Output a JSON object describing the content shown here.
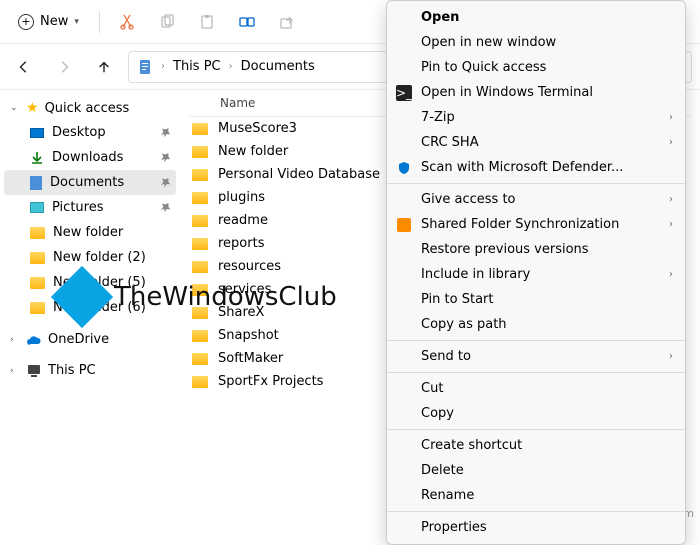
{
  "toolbar": {
    "new_label": "New"
  },
  "breadcrumb": {
    "segments": [
      "This PC",
      "Documents"
    ]
  },
  "sidebar": {
    "quick_access": "Quick access",
    "items": [
      {
        "label": "Desktop",
        "pinned": true,
        "icon": "desktop"
      },
      {
        "label": "Downloads",
        "pinned": true,
        "icon": "downloads"
      },
      {
        "label": "Documents",
        "pinned": true,
        "icon": "documents",
        "selected": true
      },
      {
        "label": "Pictures",
        "pinned": true,
        "icon": "pictures"
      },
      {
        "label": "New folder",
        "pinned": false,
        "icon": "folder"
      },
      {
        "label": "New folder (2)",
        "pinned": false,
        "icon": "folder"
      },
      {
        "label": "New folder (5)",
        "pinned": false,
        "icon": "folder"
      },
      {
        "label": "New folder (6)",
        "pinned": false,
        "icon": "folder"
      }
    ],
    "onedrive": "OneDrive",
    "this_pc": "This PC"
  },
  "content": {
    "column_header": "Name",
    "folders": [
      "MuseScore3",
      "New folder",
      "Personal Video Database",
      "plugins",
      "readme",
      "reports",
      "resources",
      "services",
      "ShareX",
      "Snapshot",
      "SoftMaker",
      "SportFx Projects"
    ]
  },
  "context_menu": {
    "groups": [
      [
        {
          "label": "Open",
          "bold": true
        },
        {
          "label": "Open in new window"
        },
        {
          "label": "Pin to Quick access"
        },
        {
          "label": "Open in Windows Terminal",
          "icon": "terminal"
        },
        {
          "label": "7-Zip",
          "submenu": true
        },
        {
          "label": "CRC SHA",
          "submenu": true
        },
        {
          "label": "Scan with Microsoft Defender...",
          "icon": "shield"
        }
      ],
      [
        {
          "label": "Give access to",
          "submenu": true
        },
        {
          "label": "Shared Folder Synchronization",
          "submenu": true,
          "icon": "sync"
        },
        {
          "label": "Restore previous versions"
        },
        {
          "label": "Include in library",
          "submenu": true
        },
        {
          "label": "Pin to Start"
        },
        {
          "label": "Copy as path"
        }
      ],
      [
        {
          "label": "Send to",
          "submenu": true
        }
      ],
      [
        {
          "label": "Cut"
        },
        {
          "label": "Copy"
        }
      ],
      [
        {
          "label": "Create shortcut"
        },
        {
          "label": "Delete"
        },
        {
          "label": "Rename"
        }
      ],
      [
        {
          "label": "Properties"
        }
      ]
    ]
  },
  "watermark": "TheWindowsClub",
  "footer": "wsxdn.com"
}
